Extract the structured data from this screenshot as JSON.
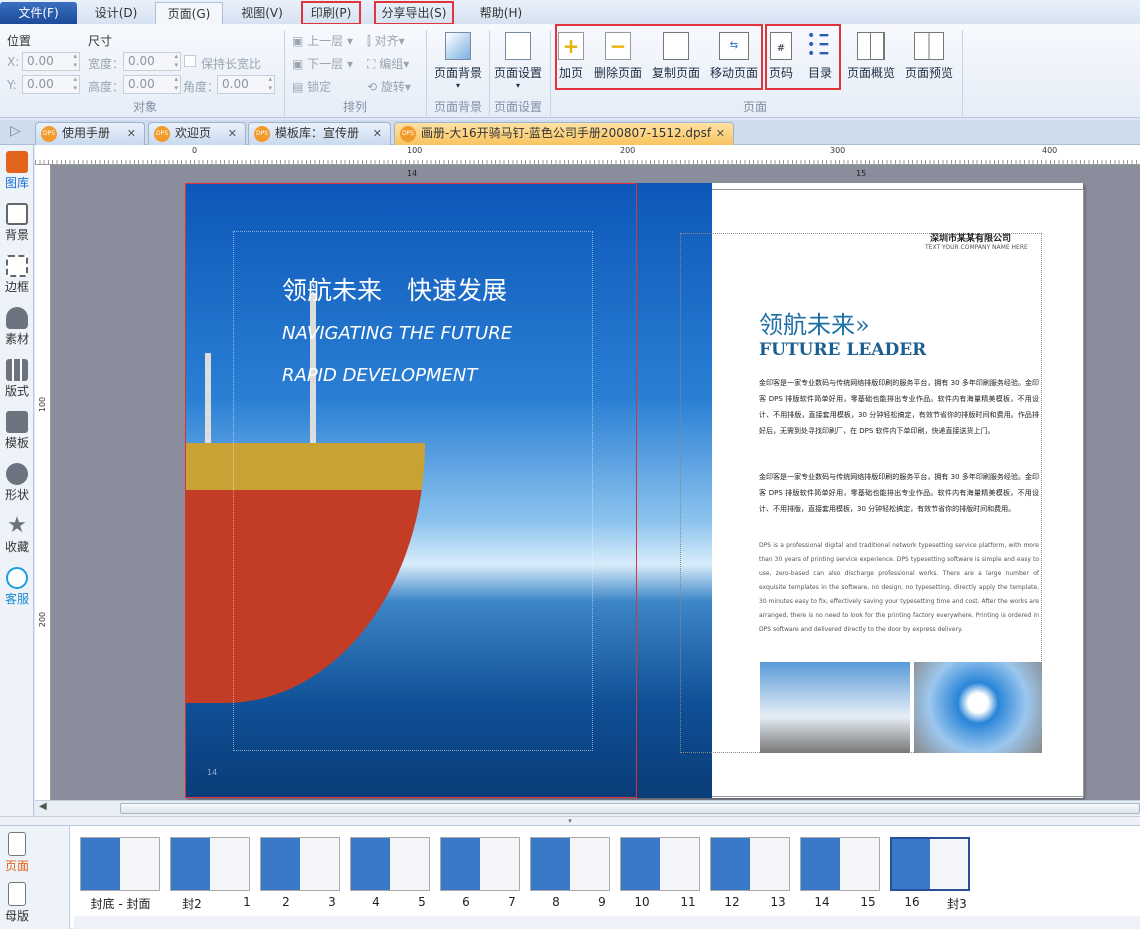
{
  "menu": [
    "文件(F)",
    "设计(D)",
    "页面(G)",
    "视图(V)",
    "印刷(P)",
    "分享导出(S)",
    "帮助(H)"
  ],
  "ribbon": {
    "pos_label": "位置",
    "size_label": "尺寸",
    "x_label": "X:",
    "y_label": "Y:",
    "x": "0.00",
    "y": "0.00",
    "width_label": "宽度：",
    "height_label": "高度：",
    "width": "0.00",
    "height": "0.00",
    "angle_label": "角度：",
    "angle": "0.00",
    "keep_ratio": "保持长宽比",
    "group_object": "对象",
    "up": "上一层",
    "down": "下一层",
    "lock": "锁定",
    "align": "对齐",
    "group": "编组",
    "rotate": "旋转",
    "group_arrange": "排列",
    "page_bg": "页面背景",
    "group_page_bg": "页面背景",
    "page_setup": "页面设置",
    "group_page_setup": "页面设置",
    "add_page": "加页",
    "delete_page": "删除页面",
    "copy_page": "复制页面",
    "move_page": "移动页面",
    "page_number": "页码",
    "toc": "目录",
    "page_overview": "页面概览",
    "page_preview": "页面预览",
    "group_page": "页面"
  },
  "doc_tabs": [
    {
      "icon": "DPS",
      "label": "使用手册"
    },
    {
      "icon": "DPS",
      "label": "欢迎页"
    },
    {
      "icon": "DPS",
      "label": "模板库：宣传册"
    },
    {
      "icon": "DPS",
      "label": "画册-大16开骑马钉-蓝色公司手册200807-1512.dpsf"
    }
  ],
  "sidebar": [
    "图库",
    "背景",
    "边框",
    "素材",
    "版式",
    "模板",
    "形状",
    "收藏",
    "客服"
  ],
  "ruler": {
    "h": [
      "0",
      "100",
      "200",
      "300",
      "400"
    ],
    "v": [
      "100",
      "200"
    ],
    "pages": [
      "14",
      "15"
    ]
  },
  "left_page": {
    "title_cn": "领航未来　快速发展",
    "title_en1": "NAVIGATING  THE  FUTURE",
    "title_en2": "RAPID  DEVELOPMENT",
    "page_num": "14"
  },
  "right_page": {
    "company_cn": "深圳市某某有限公司",
    "company_en": "TEXT YOUR COMPANY NAME HERE",
    "heading_cn": "领航未来»",
    "heading_en": "FUTURE  LEADER",
    "para1": "金印客是一家专业数码与传统网络排版印刷的服务平台，拥有 30 多年印刷服务经验。金印客 DPS 排版软件简单好用，零基础也能排出专业作品。软件内有海量精美模板，不用设计、不用排版，直接套用模板，30 分钟轻松搞定，有效节省你的排版时间和费用。作品排好后，无需到处寻找印刷厂，在 DPS 软件内下单印刷，快递直接送货上门。",
    "para2": "金印客是一家专业数码与传统网络排版印刷的服务平台，拥有 30 多年印刷服务经验。金印客 DPS 排版软件简单好用，零基础也能排出专业作品。软件内有海量精美模板，不用设计、不用排版，直接套用模板，30 分钟轻松搞定，有效节省你的排版时间和费用。",
    "para3": "DPS is a professional digital and traditional network typesetting service platform, with more than 30 years of printing service experience. DPS typesetting software is simple and easy to use, zero-based can also discharge professional works. There are a large number of exquisite templates in the software, no design, no typesetting, directly apply the template, 30 minutes easy to fix, effectively saving your typesetting time and cost. After the works are arranged, there is no need to look for the printing factory everywhere. Printing is ordered in DPS software and delivered directly to the door by express delivery."
  },
  "bottom_side": [
    "页面",
    "母版"
  ],
  "thumbs": [
    "封底 - 封面",
    "封2",
    "1",
    "2",
    "3",
    "4",
    "5",
    "6",
    "7",
    "8",
    "9",
    "10",
    "11",
    "12",
    "13",
    "14",
    "15",
    "16",
    "封3"
  ]
}
